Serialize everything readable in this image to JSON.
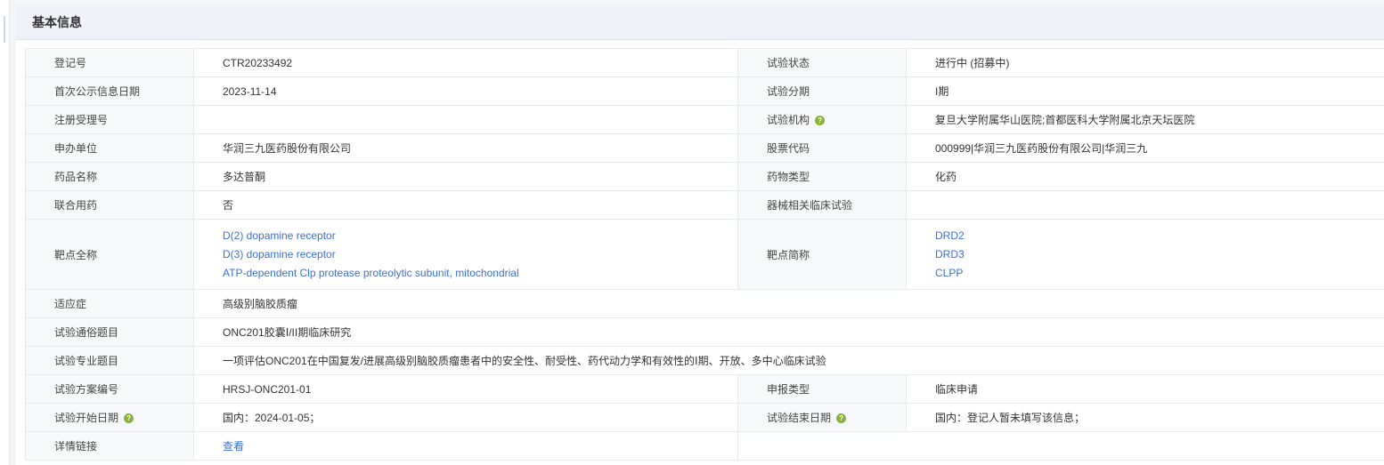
{
  "section_title": "基本信息",
  "rows": {
    "r1": {
      "l1": "登记号",
      "v1": "CTR20233492",
      "l2": "试验状态",
      "v2": "进行中 (招募中)"
    },
    "r2": {
      "l1": "首次公示信息日期",
      "v1": "2023-11-14",
      "l2": "试验分期",
      "v2": "I期"
    },
    "r3": {
      "l1": "注册受理号",
      "v1": "",
      "l2": "试验机构",
      "v2": "复旦大学附属华山医院;首都医科大学附属北京天坛医院"
    },
    "r4": {
      "l1": "申办单位",
      "v1": "华润三九医药股份有限公司",
      "l2": "股票代码",
      "v2": "000999|华润三九医药股份有限公司|华润三九"
    },
    "r5": {
      "l1": "药品名称",
      "v1": "多达普酮",
      "l2": "药物类型",
      "v2": "化药"
    },
    "r6": {
      "l1": "联合用药",
      "v1": "否",
      "l2": "器械相关临床试验",
      "v2": ""
    },
    "r7": {
      "l1": "靶点全称",
      "targets": [
        "D(2) dopamine receptor",
        "D(3) dopamine receptor",
        "ATP-dependent Clp protease proteolytic subunit, mitochondrial"
      ],
      "l2": "靶点简称",
      "abbr": [
        "DRD2",
        "DRD3",
        "CLPP"
      ]
    },
    "r8": {
      "l1": "适应症",
      "v1": "高级别脑胶质瘤"
    },
    "r9": {
      "l1": "试验通俗题目",
      "v1": "ONC201胶囊Ⅰ/II期临床研究"
    },
    "r10": {
      "l1": "试验专业题目",
      "v1": "一项评估ONC201在中国复发/进展高级别脑胶质瘤患者中的安全性、耐受性、药代动力学和有效性的Ⅰ期、开放、多中心临床试验"
    },
    "r11": {
      "l1": "试验方案编号",
      "v1": "HRSJ-ONC201-01",
      "l2": "申报类型",
      "v2": "临床申请"
    },
    "r12": {
      "l1": "试验开始日期",
      "v1": "国内：2024-01-05；",
      "l2": "试验结束日期",
      "v2": "国内：登记人暂未填写该信息；"
    },
    "r13": {
      "l1": "详情链接",
      "v1": "查看"
    }
  },
  "help_glyph": "?",
  "colors": {
    "link": "#3a6fd8",
    "help_badge": "#8ab23a",
    "label_bg": "#f7f8fa",
    "header_bg": "#eef2f8"
  }
}
